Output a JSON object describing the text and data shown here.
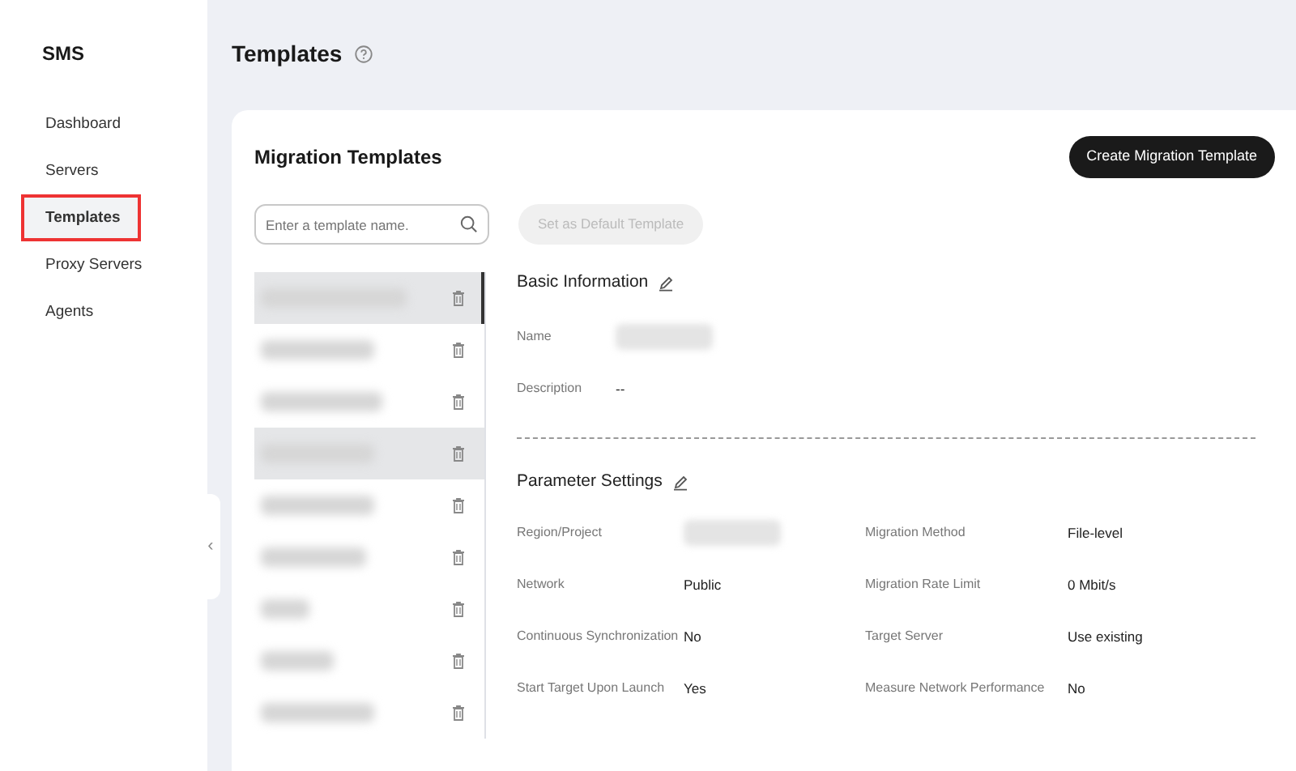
{
  "sidebar": {
    "title": "SMS",
    "items": [
      {
        "label": "Dashboard",
        "selected": false,
        "outlined": false
      },
      {
        "label": "Servers",
        "selected": false,
        "outlined": false
      },
      {
        "label": "Templates",
        "selected": true,
        "outlined": true
      },
      {
        "label": "Proxy Servers",
        "selected": false,
        "outlined": false
      },
      {
        "label": "Agents",
        "selected": false,
        "outlined": false
      }
    ]
  },
  "page_title": "Templates",
  "card": {
    "title": "Migration Templates",
    "create_button": "Create Migration Template",
    "search": {
      "placeholder": "Enter a template name."
    },
    "default_button": {
      "label": "Set as Default Template",
      "disabled": true
    },
    "templates": [
      {
        "selected": true,
        "hovered": true
      },
      {
        "selected": false,
        "hovered": false
      },
      {
        "selected": false,
        "hovered": false
      },
      {
        "selected": false,
        "hovered": true
      },
      {
        "selected": false,
        "hovered": false
      },
      {
        "selected": false,
        "hovered": false
      },
      {
        "selected": false,
        "hovered": false
      },
      {
        "selected": false,
        "hovered": false
      },
      {
        "selected": false,
        "hovered": false
      }
    ],
    "basic_info": {
      "title": "Basic Information",
      "fields": [
        {
          "label": "Name",
          "redacted": true
        },
        {
          "label": "Description",
          "value": "--"
        }
      ]
    },
    "parameters": {
      "title": "Parameter Settings",
      "fields": [
        {
          "label": "Region/Project",
          "redacted": true
        },
        {
          "label": "Migration Method",
          "value": "File-level"
        },
        {
          "label": "Network",
          "value": "Public"
        },
        {
          "label": "Migration Rate Limit",
          "value": "0 Mbit/s"
        },
        {
          "label": "Continuous Synchronization",
          "value": "No"
        },
        {
          "label": "Target Server",
          "value": "Use existing"
        },
        {
          "label": "Start Target Upon Launch",
          "value": "Yes"
        },
        {
          "label": "Measure Network Performance",
          "value": "No"
        }
      ]
    }
  },
  "collapse_handle": "‹"
}
